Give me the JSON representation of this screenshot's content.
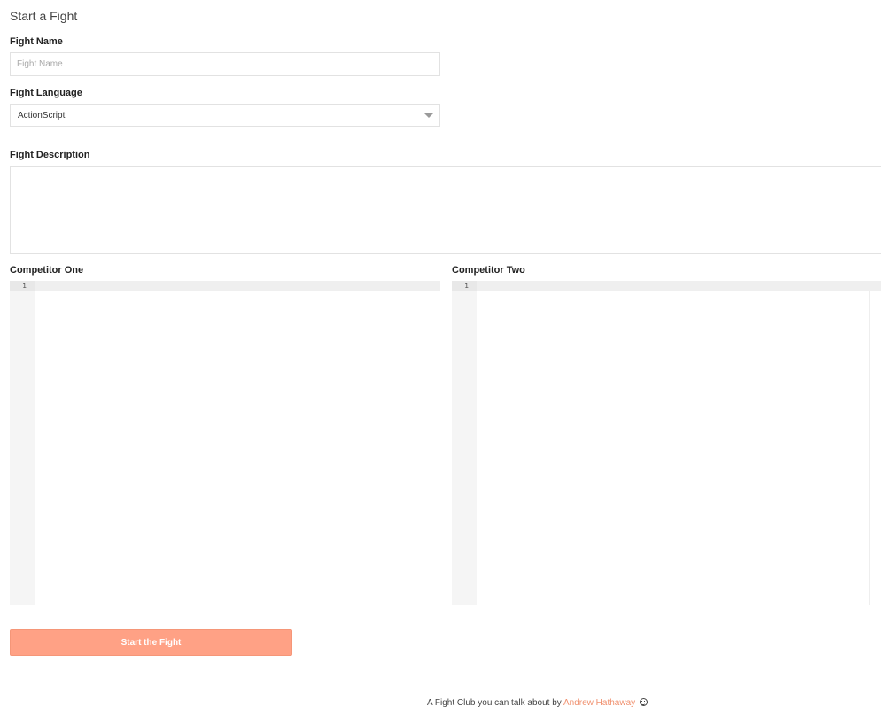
{
  "page": {
    "title": "Start a Fight"
  },
  "form": {
    "name_label": "Fight Name",
    "name_placeholder": "Fight Name",
    "name_value": "",
    "language_label": "Fight Language",
    "language_selected": "ActionScript",
    "description_label": "Fight Description",
    "description_value": ""
  },
  "competitors": {
    "one": {
      "label": "Competitor One",
      "line_numbers": [
        "1"
      ]
    },
    "two": {
      "label": "Competitor Two",
      "line_numbers": [
        "1"
      ]
    }
  },
  "actions": {
    "submit_label": "Start the Fight"
  },
  "footer": {
    "prefix": "A Fight Club you can talk about by ",
    "author_link": "Andrew Hathaway",
    "link_color": "#f0906e"
  },
  "colors": {
    "accent_button": "#ffa185",
    "border": "#e2e2e2",
    "gutter": "#f5f5f5"
  }
}
